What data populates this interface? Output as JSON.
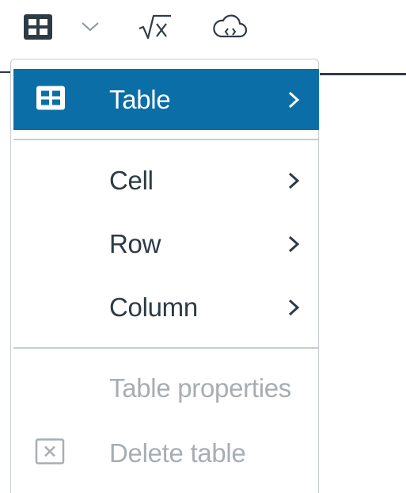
{
  "toolbar": {
    "buttons": [
      {
        "icon": "table-grid-icon"
      },
      {
        "icon": "chevron-down-icon"
      },
      {
        "icon": "square-root-icon"
      },
      {
        "icon": "cloud-embed-icon"
      }
    ]
  },
  "menu": {
    "items": [
      {
        "label": "Table",
        "icon": "table-grid-icon",
        "submenu": true,
        "highlighted": true,
        "disabled": false
      },
      {
        "label": "Cell",
        "submenu": true,
        "disabled": false
      },
      {
        "label": "Row",
        "submenu": true,
        "disabled": false
      },
      {
        "label": "Column",
        "submenu": true,
        "disabled": false
      },
      {
        "label": "Table properties",
        "submenu": false,
        "disabled": true
      },
      {
        "label": "Delete table",
        "icon": "delete-table-icon",
        "submenu": false,
        "disabled": true
      }
    ]
  },
  "colors": {
    "highlight": "#0b6ea6",
    "text": "#2d3b45",
    "disabled_text": "#a6aeb3",
    "divider": "#c7cdd1"
  }
}
